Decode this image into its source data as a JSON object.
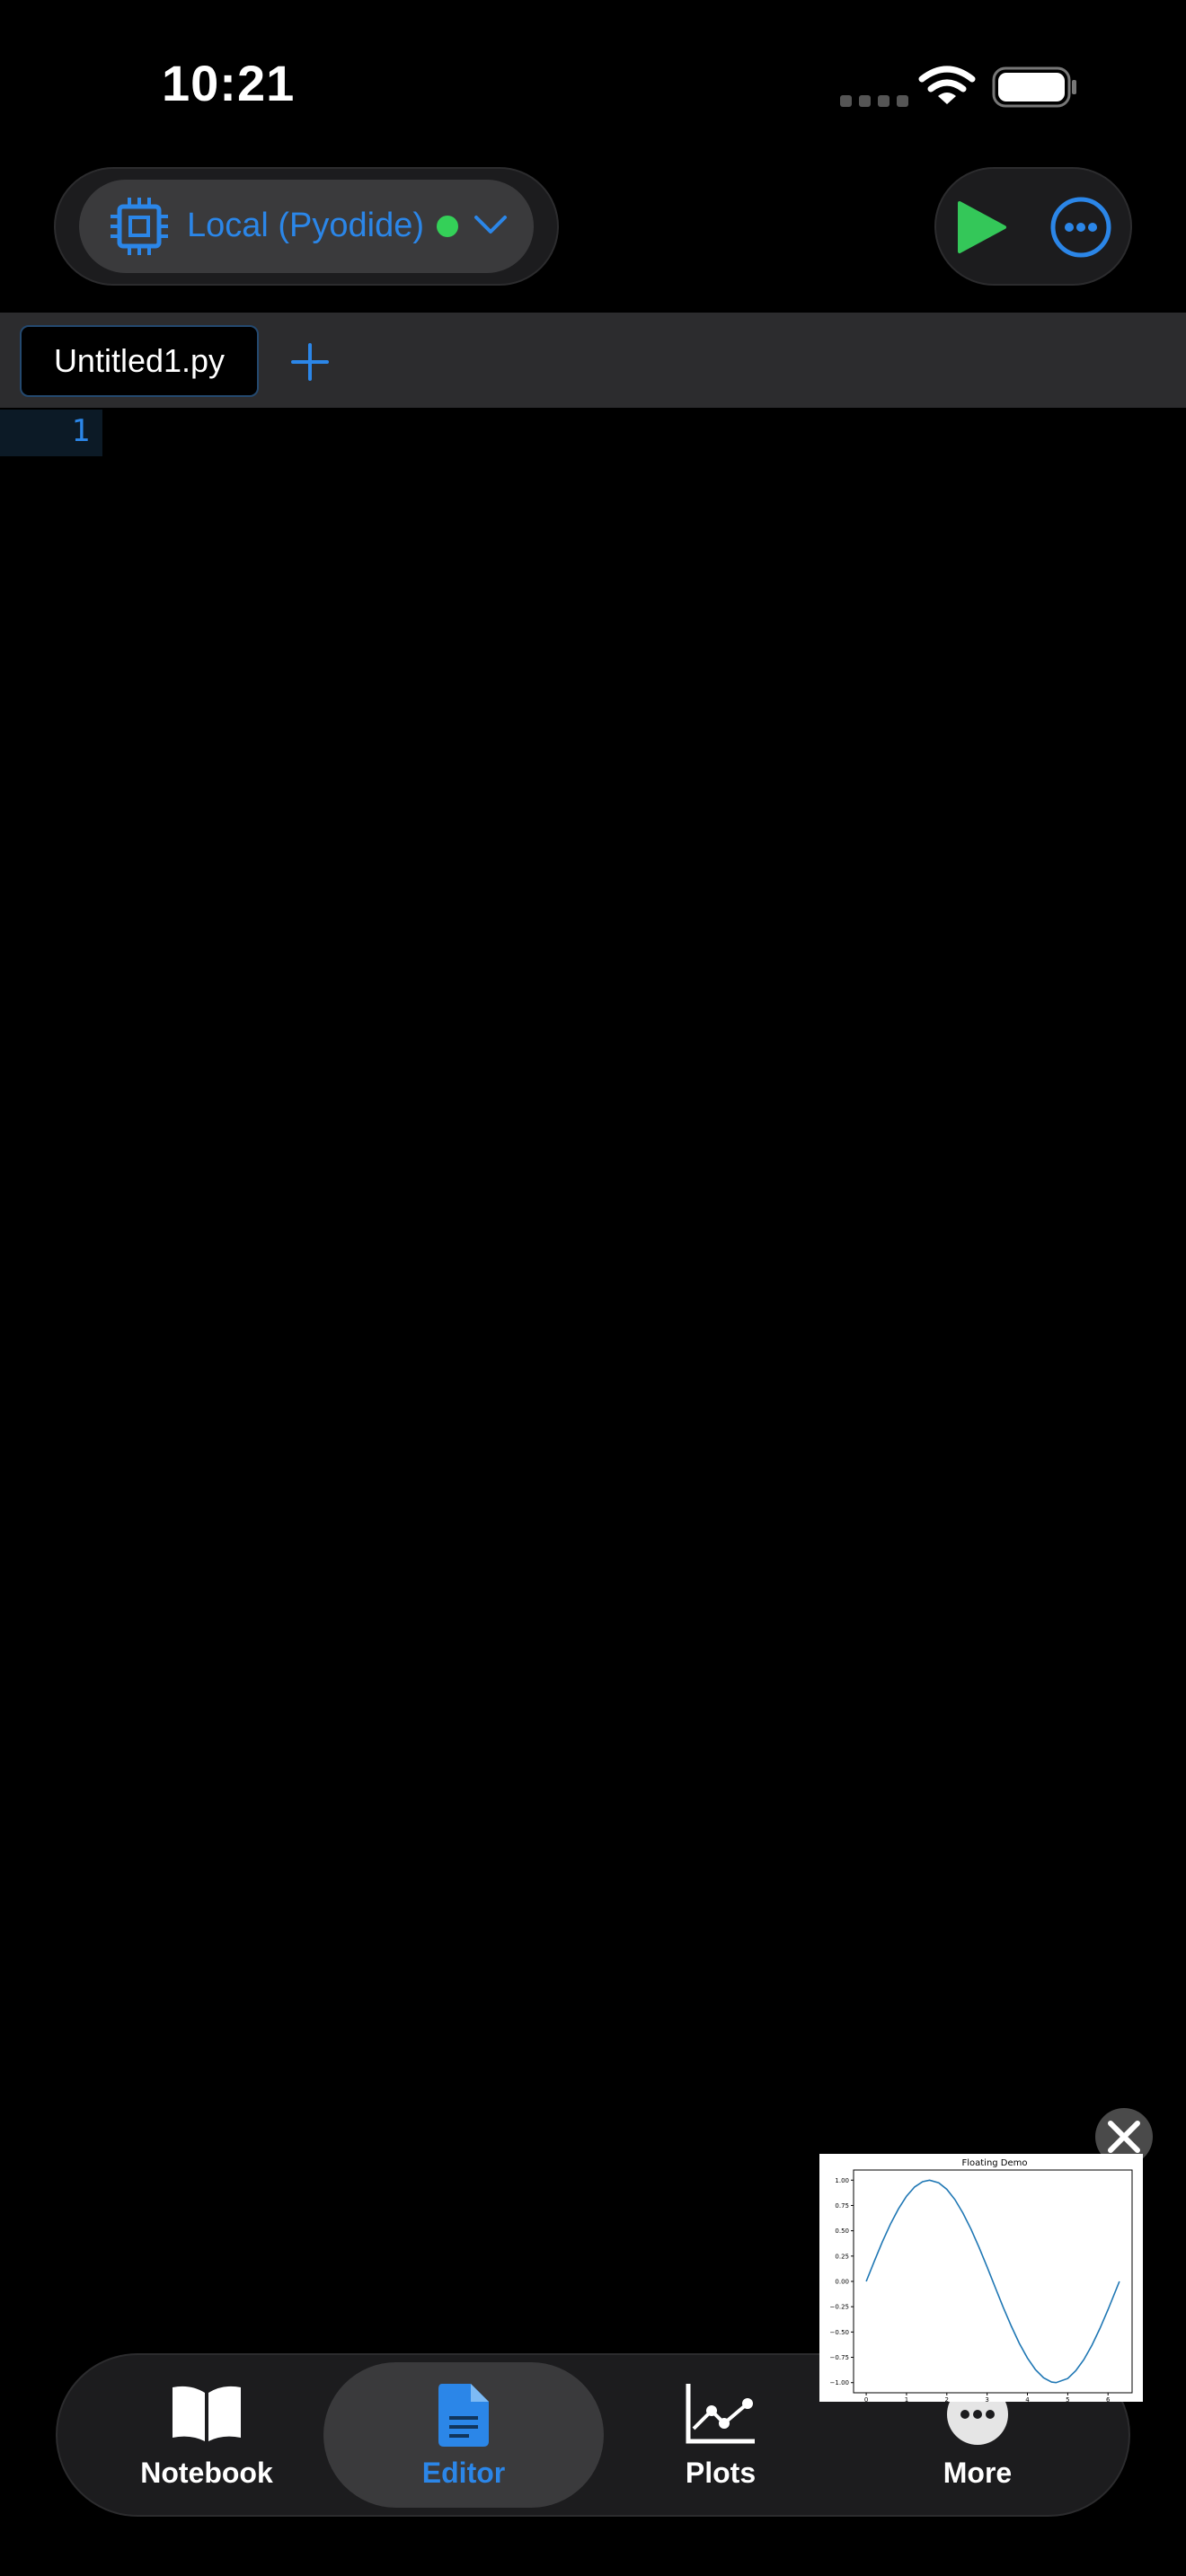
{
  "status_bar": {
    "time": "10:21"
  },
  "kernel": {
    "label": "Local (Pyodide)",
    "status_color": "#34d058"
  },
  "tabs": [
    {
      "label": "Untitled1.py"
    }
  ],
  "editor": {
    "line_numbers": [
      "1"
    ]
  },
  "bottom_nav": {
    "items": [
      {
        "label": "Notebook",
        "icon": "book-icon"
      },
      {
        "label": "Editor",
        "icon": "document-icon",
        "active": true
      },
      {
        "label": "Plots",
        "icon": "chart-icon"
      },
      {
        "label": "More",
        "icon": "ellipsis-icon"
      }
    ]
  },
  "floating_plot": {
    "title": "Floating Demo",
    "chart_data": {
      "type": "line",
      "title": "Floating Demo",
      "x": [
        0,
        0.2,
        0.4,
        0.6,
        0.8,
        1.0,
        1.2,
        1.4,
        1.571,
        1.8,
        2.0,
        2.2,
        2.4,
        2.6,
        2.8,
        3.0,
        3.2,
        3.4,
        3.6,
        3.8,
        4.0,
        4.2,
        4.4,
        4.6,
        4.712,
        5.0,
        5.2,
        5.4,
        5.6,
        5.8,
        6.0,
        6.283
      ],
      "values": [
        0,
        0.199,
        0.389,
        0.565,
        0.717,
        0.841,
        0.932,
        0.985,
        1.0,
        0.974,
        0.909,
        0.808,
        0.675,
        0.516,
        0.335,
        0.141,
        -0.058,
        -0.256,
        -0.443,
        -0.612,
        -0.757,
        -0.872,
        -0.952,
        -0.994,
        -1.0,
        -0.959,
        -0.883,
        -0.773,
        -0.631,
        -0.465,
        -0.279,
        0
      ],
      "xlim": [
        -0.314,
        6.597
      ],
      "ylim": [
        -1.1,
        1.1
      ],
      "xticks": [
        "0",
        "1",
        "2",
        "3",
        "4",
        "5",
        "6"
      ],
      "yticks": [
        "1.00",
        "0.75",
        "0.50",
        "0.25",
        "0.00",
        "−0.25",
        "−0.50",
        "−0.75",
        "−1.00"
      ],
      "line_color": "#1f77b4",
      "grid": false
    }
  },
  "colors": {
    "accent": "#2b86e8",
    "run": "#34c759",
    "background": "#000000"
  }
}
